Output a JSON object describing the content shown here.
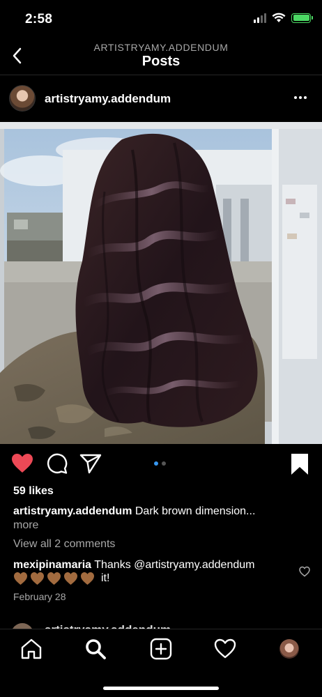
{
  "status": {
    "time": "2:58"
  },
  "nav": {
    "subtitle": "ARTISTRYAMY.ADDENDUM",
    "title": "Posts"
  },
  "post": {
    "username": "artistryamy.addendum",
    "likes": "59 likes",
    "caption_user": "artistryamy.addendum",
    "caption_text": "Dark brown dimension...",
    "more": "more",
    "view_comments": "View all 2 comments",
    "comment_user": "mexipinamaria",
    "comment_text": "Thanks @artistryamy.addendum",
    "comment_tail": "it!",
    "date": "February 28",
    "carousel_active": 1,
    "carousel_count": 2
  },
  "next_post": {
    "username": "artistryamy.addendum"
  },
  "colors": {
    "like_red": "#ed4956",
    "carousel_blue": "#3797f0",
    "battery_green": "#4cd964",
    "brown_heart": "#a26b3f"
  },
  "icons": [
    "back-arrow",
    "more-dots",
    "heart-filled",
    "comment-bubble",
    "share-paper-plane",
    "bookmark-filled",
    "home",
    "search",
    "add-post",
    "activity-heart",
    "profile-avatar"
  ]
}
